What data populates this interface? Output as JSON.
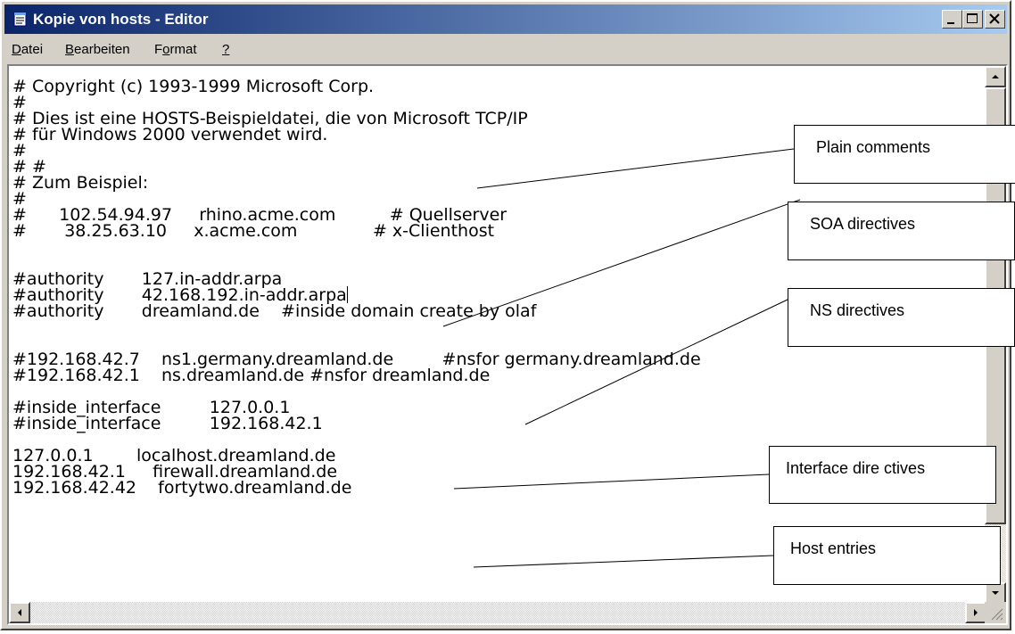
{
  "window": {
    "title": "Kopie von hosts - Editor",
    "icon": "notepad-icon",
    "controls": [
      "minimize-icon",
      "maximize-icon",
      "close-icon"
    ]
  },
  "menu": {
    "items": [
      {
        "label": "Datei",
        "mnemonic": "D"
      },
      {
        "label": "Bearbeiten",
        "mnemonic": "B"
      },
      {
        "label": "Format",
        "mnemonic": "o"
      },
      {
        "label": "?",
        "mnemonic": "?"
      }
    ]
  },
  "editor": {
    "lines": [
      "# Copyright (c) 1993-1999 Microsoft Corp.",
      "#",
      "# Dies ist eine HOSTS-Beispieldatei, die von Microsoft TCP/IP",
      "# für Windows 2000 verwendet wird.",
      "#",
      "# #",
      "# Zum Beispiel:",
      "#",
      "#      102.54.94.97     rhino.acme.com          # Quellserver",
      "#       38.25.63.10     x.acme.com              # x-Clienthost",
      "",
      "",
      "#authority       127.in-addr.arpa",
      "#authority       42.168.192.in-addr.arpa",
      "#authority       dreamland.de    #inside domain create by olaf",
      "",
      "",
      "#192.168.42.7    ns1.germany.dreamland.de         #nsfor germany.dreamland.de",
      "#192.168.42.1    ns.dreamland.de #nsfor dreamland.de",
      "",
      "#inside_interface         127.0.0.1",
      "#inside_interface         192.168.42.1",
      "",
      "127.0.0.1        localhost.dreamland.de",
      "192.168.42.1     firewall.dreamland.de",
      "192.168.42.42    fortytwo.dreamland.de"
    ]
  },
  "annotations": [
    {
      "label": "Plain comments"
    },
    {
      "label": "SOA directives"
    },
    {
      "label": "NS directives"
    },
    {
      "label": "Interface dire ctives"
    },
    {
      "label": "Host entries"
    }
  ],
  "colors": {
    "titlebar_start": "#0a246a",
    "titlebar_end": "#a6caf0",
    "chrome": "#d4d0c8"
  }
}
